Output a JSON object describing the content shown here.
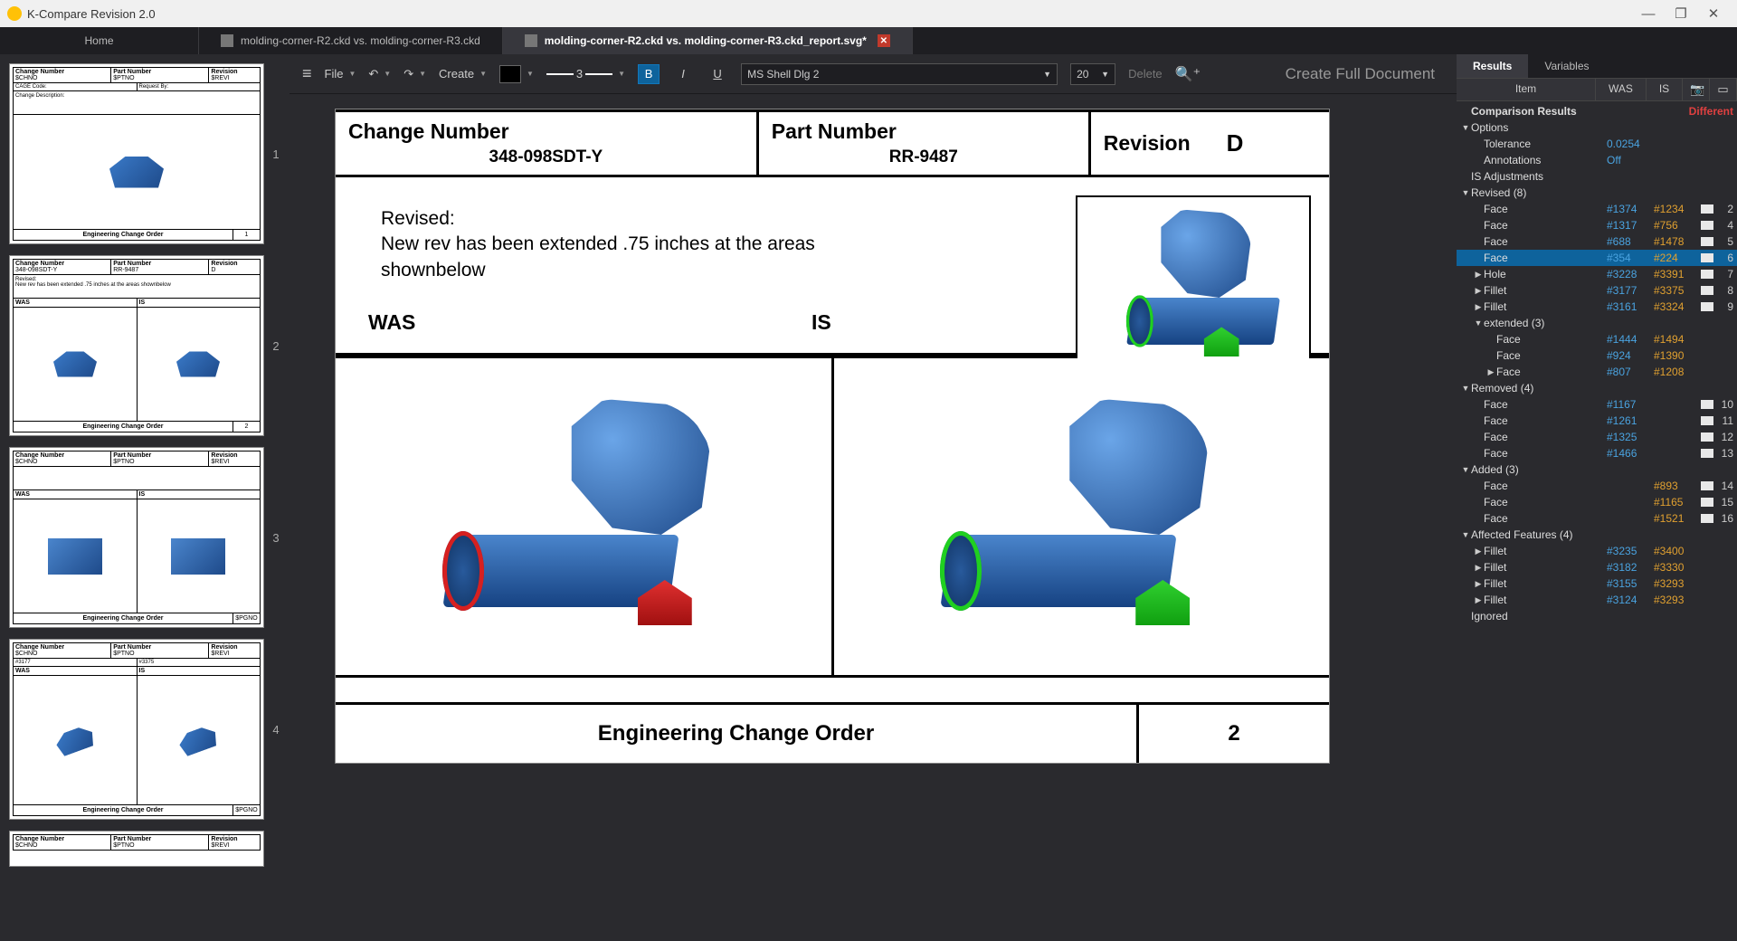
{
  "app": {
    "title": "K-Compare Revision 2.0"
  },
  "tabs": {
    "home": "Home",
    "doc1": "molding-corner-R2.ckd vs. molding-corner-R3.ckd",
    "doc2": "molding-corner-R2.ckd vs. molding-corner-R3.ckd_report.svg*"
  },
  "toolbar": {
    "file": "File",
    "create": "Create",
    "stroke_width": "3",
    "bold": "B",
    "italic": "I",
    "underline": "U",
    "font_name": "MS Shell Dlg 2",
    "font_size": "20",
    "delete": "Delete",
    "create_doc": "Create Full Document"
  },
  "doc": {
    "change_number_label": "Change Number",
    "change_number": "348-098SDT-Y",
    "part_number_label": "Part Number",
    "part_number": "RR-9487",
    "revision_label": "Revision",
    "revision": "D",
    "revised_label": "Revised:",
    "revised_text": "New rev has been extended .75 inches at the areas shownbelow",
    "was": "WAS",
    "is": "IS",
    "eco": "Engineering Change Order",
    "page": "2"
  },
  "thumbs": {
    "t1": {
      "cn_lbl": "Change Number",
      "cn": "$CHNO",
      "pn_lbl": "Part Number",
      "pn": "$PTNO",
      "rev_lbl": "Revision",
      "rev": "$REVI",
      "cage": "CAGE Code:",
      "req": "Request By:",
      "desc": "Change Description:",
      "eco": "Engineering Change Order",
      "pg": "1"
    },
    "t2": {
      "cn_lbl": "Change Number",
      "cn": "348-098SDT-Y",
      "pn_lbl": "Part Number",
      "pn": "RR-9487",
      "rev_lbl": "Revision",
      "rev": "D",
      "desc1": "Revised:",
      "desc2": "New rev has been extended .75 inches at the areas shownbelow",
      "was": "WAS",
      "is": "IS",
      "eco": "Engineering Change Order",
      "pg": "2"
    },
    "t3": {
      "cn_lbl": "Change Number",
      "cn": "$CHNO",
      "pn_lbl": "Part Number",
      "pn": "$PTNO",
      "rev_lbl": "Revision",
      "rev": "$REVI",
      "was": "WAS",
      "is": "IS",
      "eco": "Engineering Change Order",
      "pg": "$PGNO"
    },
    "t4": {
      "cn_lbl": "Change Number",
      "cn": "$CHNO",
      "pn_lbl": "Part Number",
      "pn": "$PTNO",
      "rev_lbl": "Revision",
      "rev": "$REVI",
      "a": "#3177",
      "b": "#3375",
      "was": "WAS",
      "is": "IS",
      "eco": "Engineering Change Order",
      "pg": "$PGNO"
    },
    "t5": {
      "cn_lbl": "Change Number",
      "cn": "$CHNO",
      "pn_lbl": "Part Number",
      "pn": "$PTNO",
      "rev_lbl": "Revision",
      "rev": "$REVI"
    }
  },
  "results": {
    "tab_results": "Results",
    "tab_variables": "Variables",
    "col_item": "Item",
    "col_was": "WAS",
    "col_is": "IS",
    "comparison": "Comparison Results",
    "status": "Different",
    "options": "Options",
    "tolerance": "Tolerance",
    "tolerance_v": "0.0254",
    "annotations": "Annotations",
    "annotations_v": "Off",
    "is_adj": "IS Adjustments",
    "revised": "Revised (8)",
    "removed": "Removed (4)",
    "added": "Added (3)",
    "affected": "Affected Features (4)",
    "extended": "extended (3)",
    "ignored": "Ignored",
    "rows_revised": [
      {
        "t": "Face",
        "w": "#1374",
        "i": "#1234",
        "n": "2"
      },
      {
        "t": "Face",
        "w": "#1317",
        "i": "#756",
        "n": "4"
      },
      {
        "t": "Face",
        "w": "#688",
        "i": "#1478",
        "n": "5"
      },
      {
        "t": "Face",
        "w": "#354",
        "i": "#224",
        "n": "6",
        "sel": true
      },
      {
        "t": "Hole",
        "w": "#3228",
        "i": "#3391",
        "n": "7",
        "arrow": true
      },
      {
        "t": "Fillet",
        "w": "#3177",
        "i": "#3375",
        "n": "8",
        "arrow": true
      },
      {
        "t": "Fillet",
        "w": "#3161",
        "i": "#3324",
        "n": "9",
        "arrow": true
      }
    ],
    "rows_extended": [
      {
        "t": "Face",
        "w": "#1444",
        "i": "#1494"
      },
      {
        "t": "Face",
        "w": "#924",
        "i": "#1390"
      },
      {
        "t": "Face",
        "w": "#807",
        "i": "#1208",
        "arrow": true
      }
    ],
    "rows_removed": [
      {
        "t": "Face",
        "w": "#1167",
        "n": "10"
      },
      {
        "t": "Face",
        "w": "#1261",
        "n": "11"
      },
      {
        "t": "Face",
        "w": "#1325",
        "n": "12"
      },
      {
        "t": "Face",
        "w": "#1466",
        "n": "13"
      }
    ],
    "rows_added": [
      {
        "t": "Face",
        "i": "#893",
        "n": "14"
      },
      {
        "t": "Face",
        "i": "#1165",
        "n": "15"
      },
      {
        "t": "Face",
        "i": "#1521",
        "n": "16"
      }
    ],
    "rows_affected": [
      {
        "t": "Fillet",
        "w": "#3235",
        "i": "#3400",
        "arrow": true
      },
      {
        "t": "Fillet",
        "w": "#3182",
        "i": "#3330",
        "arrow": true
      },
      {
        "t": "Fillet",
        "w": "#3155",
        "i": "#3293",
        "arrow": true
      },
      {
        "t": "Fillet",
        "w": "#3124",
        "i": "#3293",
        "arrow": true
      }
    ]
  }
}
